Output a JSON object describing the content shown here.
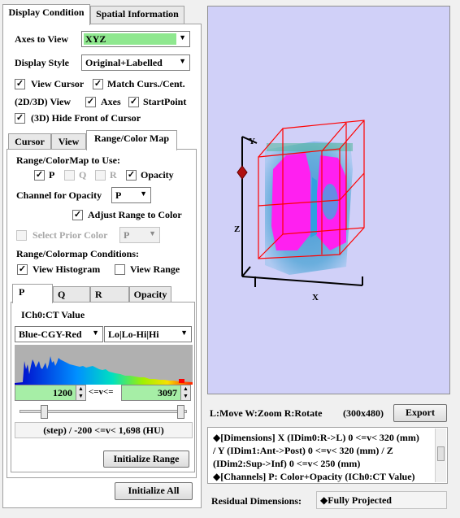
{
  "tabs": {
    "display_condition": "Display Condition",
    "spatial_information": "Spatial Information"
  },
  "axes_to_view": {
    "label": "Axes to View",
    "value": "XYZ"
  },
  "display_style": {
    "label": "Display Style",
    "value": "Original+Labelled"
  },
  "view_cursor": {
    "label": "View Cursor",
    "checked": true
  },
  "match_curs": {
    "label": "Match Curs./Cent.",
    "checked": true
  },
  "view_2d3d": {
    "label": "(2D/3D) View"
  },
  "axes_cb": {
    "label": "Axes",
    "checked": true
  },
  "startpoint_cb": {
    "label": "StartPoint",
    "checked": true
  },
  "hide_front": {
    "label": "(3D) Hide Front of Cursor",
    "checked": true
  },
  "subtabs": {
    "cursor": "Cursor",
    "view": "View",
    "range_color_map": "Range/Color Map"
  },
  "range_to_use": {
    "label": "Range/ColorMap to Use:",
    "p": "P",
    "q": "Q",
    "r": "R",
    "opacity": "Opacity"
  },
  "channel_opacity": {
    "label": "Channel for Opacity",
    "value": "P"
  },
  "adjust_range": {
    "label": "Adjust Range to Color"
  },
  "select_prior": {
    "label": "Select Prior Color",
    "value": "P"
  },
  "range_conditions": {
    "label": "Range/Colormap Conditions:",
    "view_histogram": "View Histogram",
    "view_range": "View Range"
  },
  "channel_tabs": {
    "p": "P",
    "q": "Q",
    "r": "R",
    "opacity": "Opacity"
  },
  "channel_title": "ICh0:CT Value",
  "colormap": {
    "value": "Blue-CGY-Red",
    "mode": "Lo|Lo-Hi|Hi"
  },
  "range": {
    "low": "1200",
    "sep": "<=v<=",
    "high": "3097"
  },
  "step_text": "(step) / -200 <=v< 1,698 (HU)",
  "initialize_range": "Initialize Range",
  "initialize_all": "Initialize All",
  "viewer": {
    "axes": {
      "x": "X",
      "y": "Y",
      "z": "Z"
    },
    "hint": "L:Move W:Zoom R:Rotate",
    "size": "(300x480)",
    "export": "Export",
    "colors": {
      "background": "#d0d0f8",
      "frame": "#ff0000",
      "volume": "#ff00ff"
    }
  },
  "dimensions_info": {
    "line1": "◆[Dimensions] X (IDim0:R->L) 0 <=v< 320 (mm)",
    "line2": "/ Y (IDim1:Ant->Post) 0 <=v< 320 (mm) / Z",
    "line3": "(IDim2:Sup->Inf) 0 <=v< 250 (mm)",
    "line4": "◆[Channels] P: Color+Opacity (ICh0:CT Value)"
  },
  "residual": {
    "label": "Residual Dimensions:",
    "value": "◆Fully Projected"
  }
}
